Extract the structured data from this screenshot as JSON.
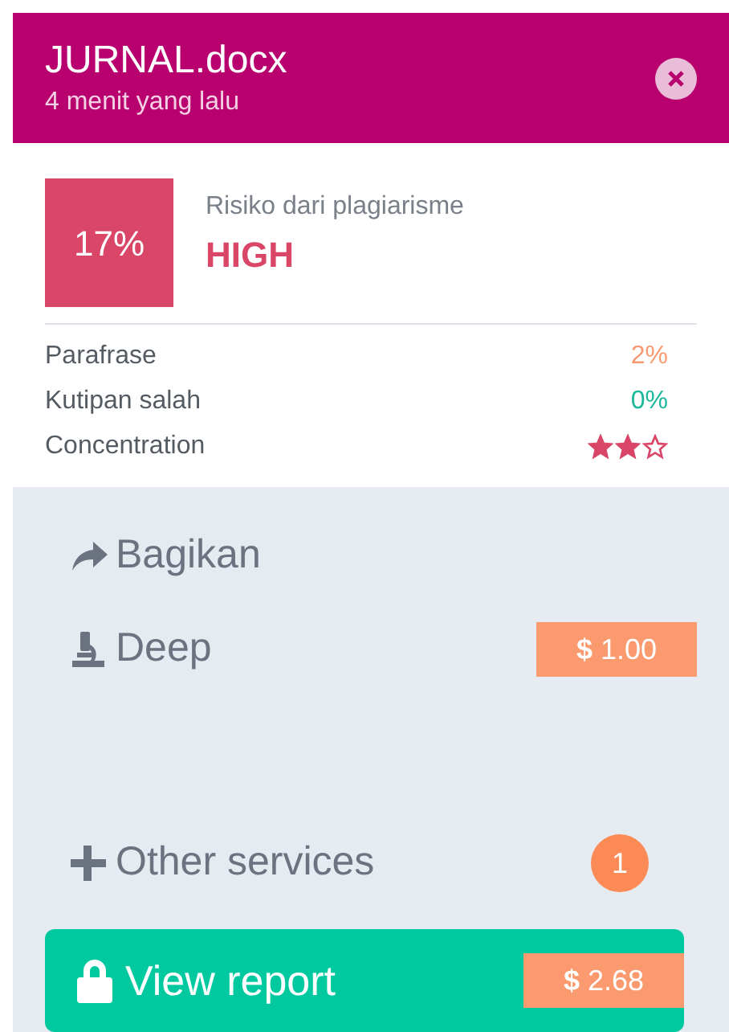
{
  "header": {
    "title": "JURNAL.docx",
    "subtitle": "4 menit yang lalu"
  },
  "risk": {
    "percent": "17%",
    "label": "Risiko dari plagiarisme",
    "level_text": "HIGH"
  },
  "metrics": [
    {
      "kind": "percent",
      "label": "Parafrase",
      "value": "2%",
      "color": "#f79a72"
    },
    {
      "kind": "percent",
      "label": "Kutipan salah",
      "value": "0%",
      "color": "#1bb89a"
    },
    {
      "kind": "stars",
      "label": "Concentration",
      "stars": 2
    }
  ],
  "actions": [
    {
      "kind": "share",
      "label": "Bagikan"
    },
    {
      "kind": "deep",
      "label": "Deep",
      "price": "**$** 1.00"
    },
    {
      "kind": "services",
      "label": "Other services",
      "badge": "1"
    }
  ],
  "view_report": {
    "label": "View report",
    "price": "**$** 2.68"
  }
}
